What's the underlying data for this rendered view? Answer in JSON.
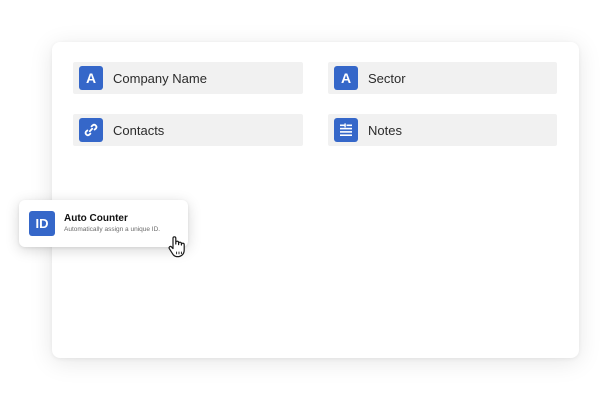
{
  "fields": [
    {
      "label": "Company Name",
      "icon": "letter-a-icon",
      "glyph": "A"
    },
    {
      "label": "Sector",
      "icon": "letter-a-icon",
      "glyph": "A"
    },
    {
      "label": "Contacts",
      "icon": "link-icon"
    },
    {
      "label": "Notes",
      "icon": "long-text-icon"
    }
  ],
  "dragged_field": {
    "glyph": "ID",
    "title": "Auto Counter",
    "description": "Automatically assign a unique ID."
  },
  "colors": {
    "accent": "#3567c9",
    "field_bg": "#f1f1f1"
  }
}
